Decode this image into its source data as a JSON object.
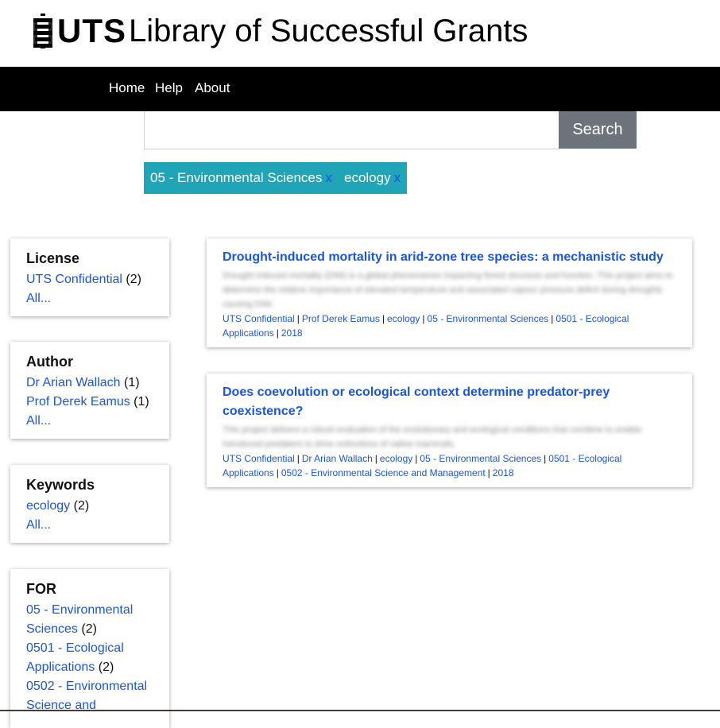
{
  "header": {
    "logo_text": "UTS",
    "site_title": "Library of Successful Grants"
  },
  "nav": {
    "items": [
      "Home",
      "Help",
      "About"
    ]
  },
  "search": {
    "value": "",
    "placeholder": "",
    "button_label": "Search"
  },
  "filters": [
    {
      "label": "05 - Environmental Sciences",
      "remove": "x"
    },
    {
      "label": "ecology",
      "remove": "x"
    }
  ],
  "facets": {
    "license": {
      "heading": "License",
      "items": [
        {
          "label": "UTS Confidential",
          "count": "(2)"
        }
      ],
      "all_label": "All..."
    },
    "author": {
      "heading": "Author",
      "items": [
        {
          "label": "Dr Arian Wallach",
          "count": "(1)"
        },
        {
          "label": "Prof Derek Eamus",
          "count": "(1)"
        }
      ],
      "all_label": "All..."
    },
    "keywords": {
      "heading": "Keywords",
      "items": [
        {
          "label": "ecology",
          "count": "(2)"
        }
      ],
      "all_label": "All..."
    },
    "for": {
      "heading": "FOR",
      "items": [
        {
          "label": "05 - Environmental Sciences",
          "count": "(2)"
        },
        {
          "label": "0501 - Ecological Applications",
          "count": "(2)"
        },
        {
          "label": "0502 - Environmental Science and",
          "count": ""
        }
      ]
    }
  },
  "results": [
    {
      "title": "Drought-induced mortality in arid-zone tree species: a mechanistic study",
      "abstract": "Drought induced mortality (DIM) is a global phenomenon impacting forest structure and function. This project aims to determine the relative importance of elevated temperature and associated vapour pressure deficit during droughts causing DIM.",
      "meta": [
        "UTS Confidential",
        "Prof Derek Eamus",
        "ecology",
        "05 - Environmental Sciences",
        "0501 - Ecological Applications",
        "2018"
      ]
    },
    {
      "title": "Does coevolution or ecological context determine predator-prey coexistence?",
      "abstract": "This project delivers a robust evaluation of the evolutionary and ecological conditions that combine to enable introduced predators to drive extinctions of native mammals.",
      "meta": [
        "UTS Confidential",
        "Dr Arian Wallach",
        "ecology",
        "05 - Environmental Sciences",
        "0501 - Ecological Applications",
        "0502 - Environmental Science and Management",
        "2018"
      ]
    }
  ],
  "colors": {
    "nav_bg": "#000000",
    "chip_bg": "#1fa4b8",
    "link": "#1a56db",
    "search_button_bg": "#6c737b"
  }
}
